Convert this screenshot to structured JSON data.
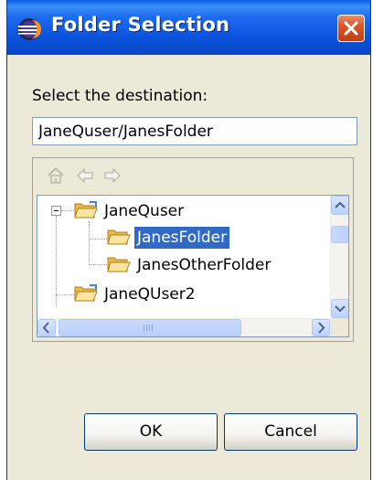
{
  "window": {
    "title": "Folder Selection"
  },
  "dialog": {
    "prompt_label": "Select the destination:",
    "path_value": "JaneQuser/JanesFolder"
  },
  "tree": {
    "items": [
      {
        "label": "JaneQuser",
        "level": 0,
        "expanded": true,
        "selected": false
      },
      {
        "label": "JanesFolder",
        "level": 1,
        "expanded": false,
        "selected": true
      },
      {
        "label": "JanesOtherFolder",
        "level": 1,
        "expanded": false,
        "selected": false
      },
      {
        "label": "JaneQUser2",
        "level": 0,
        "expanded": false,
        "selected": false
      }
    ]
  },
  "buttons": {
    "ok_label": "OK",
    "cancel_label": "Cancel"
  },
  "icons": {
    "app": "eclipse-icon",
    "close": "close-icon",
    "home": "home-icon",
    "back": "back-arrow-icon",
    "forward": "forward-arrow-icon",
    "folder": "folder-open-icon"
  },
  "colors": {
    "titlebar": "#0A51DB",
    "selection": "#316AC5",
    "dialog_bg": "#ECE9D8",
    "close_button": "#D9562A"
  }
}
